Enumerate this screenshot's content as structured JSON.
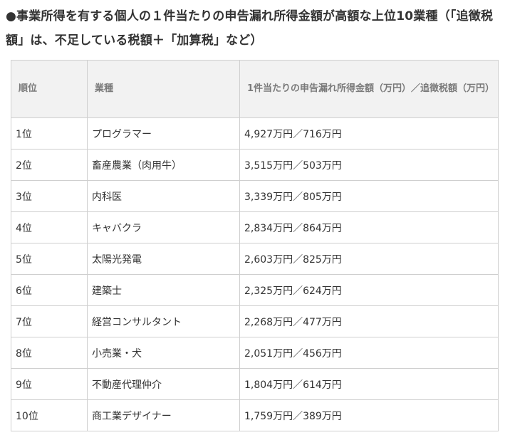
{
  "heading": "●事業所得を有する個人の１件当たりの申告漏れ所得金額が高額な上位10業種（「追徴税額」は、不足している税額＋「加算税」など）",
  "table": {
    "headers": {
      "rank": "順位",
      "industry": "業種",
      "amount": "1件当たりの申告漏れ所得金額（万円）／追徴税額（万円）"
    },
    "rows": [
      {
        "rank": "1位",
        "industry": "プログラマー",
        "amount": "4,927万円／716万円"
      },
      {
        "rank": "2位",
        "industry": "畜産農業（肉用牛）",
        "amount": "3,515万円／503万円"
      },
      {
        "rank": "3位",
        "industry": "内科医",
        "amount": "3,339万円／805万円"
      },
      {
        "rank": "4位",
        "industry": "キャバクラ",
        "amount": "2,834万円／864万円"
      },
      {
        "rank": "5位",
        "industry": "太陽光発電",
        "amount": "2,603万円／825万円"
      },
      {
        "rank": "6位",
        "industry": "建築士",
        "amount": "2,325万円／624万円"
      },
      {
        "rank": "7位",
        "industry": "経営コンサルタント",
        "amount": "2,268万円／477万円"
      },
      {
        "rank": "8位",
        "industry": "小売業・犬",
        "amount": "2,051万円／456万円"
      },
      {
        "rank": "9位",
        "industry": "不動産代理仲介",
        "amount": "1,804万円／614万円"
      },
      {
        "rank": "10位",
        "industry": "商工業デザイナー",
        "amount": "1,759万円／389万円"
      }
    ]
  }
}
